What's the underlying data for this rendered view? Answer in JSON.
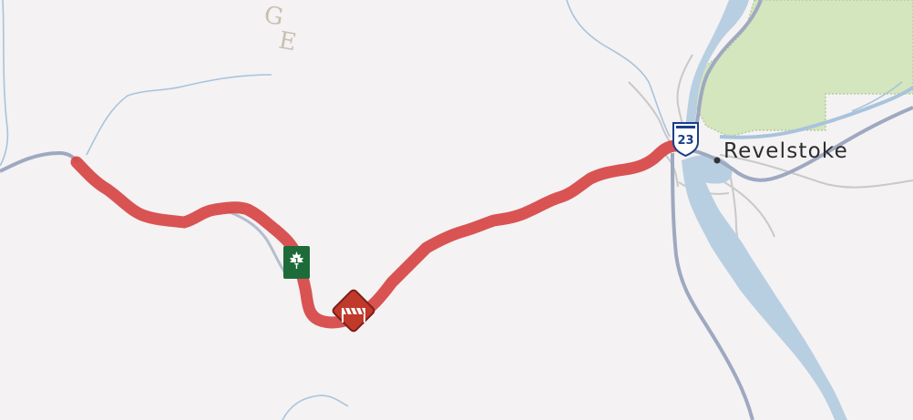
{
  "map": {
    "colors": {
      "background": "#f4f2f3",
      "park": "#d3e6bd",
      "park_border": "#b9c9a4",
      "water": "#b8cfe2",
      "water_line": "#a9c3dc",
      "highway": "#9ea9c0",
      "road": "#c9c9c9",
      "route": "#d64545",
      "closure": "#c0392b",
      "tch_green": "#1e6b3a",
      "shield_blue": "#1a3e8c"
    },
    "labels": {
      "range_partial": [
        "G",
        "E"
      ],
      "city": "Revelstoke"
    },
    "shields": {
      "highway_23": "23",
      "trans_canada": "1"
    },
    "icons": {
      "closure": "road-closure-icon",
      "trans_canada": "maple-leaf-icon",
      "shield": "highway-shield-icon",
      "city": "city-dot-icon"
    }
  }
}
